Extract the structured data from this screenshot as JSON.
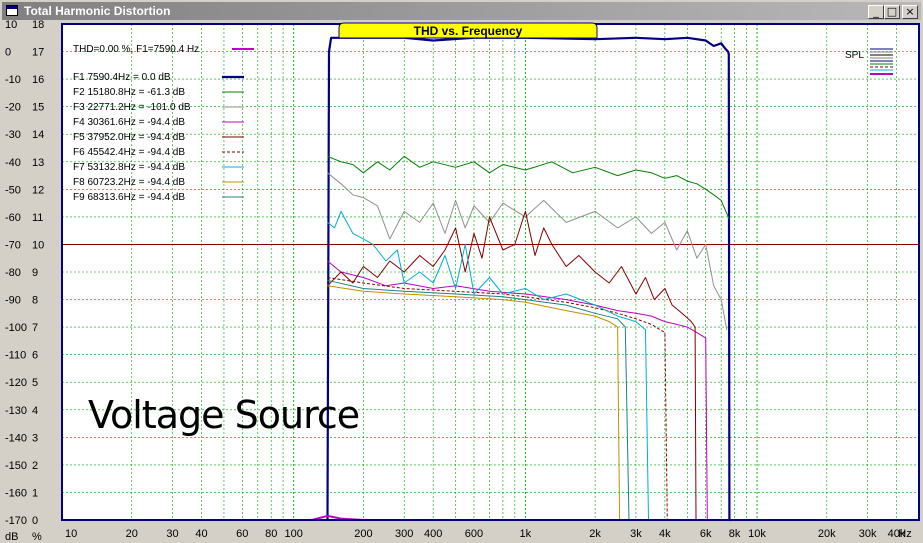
{
  "window": {
    "title": "Total Harmonic Distortion",
    "minimize_glyph": "_",
    "maximize_glyph": "□",
    "close_glyph": "×"
  },
  "colors": {
    "plot_bg": "#ffffff",
    "grid": "#00a000",
    "ref_line": "#800000",
    "title_tab": "#ffff00",
    "axis_border": "#000080"
  },
  "watermark": "Voltage Source",
  "chart_data": {
    "type": "line",
    "title": "THD vs. Frequency",
    "x_scale": "log",
    "xlim": [
      10,
      50000
    ],
    "ylim": [
      -170,
      10
    ],
    "y2lim": [
      0,
      18
    ],
    "x_ticks": [
      "10",
      "20",
      "30",
      "40",
      "60",
      "80",
      "100",
      "200",
      "300",
      "400",
      "600",
      "1k",
      "2k",
      "3k",
      "4k",
      "6k",
      "8k",
      "10k",
      "20k",
      "30k",
      "40k"
    ],
    "x_tick_values": [
      10,
      20,
      30,
      40,
      60,
      80,
      100,
      200,
      300,
      400,
      600,
      1000,
      2000,
      3000,
      4000,
      6000,
      8000,
      10000,
      20000,
      30000,
      40000
    ],
    "x_unit": "Hz",
    "y_ticks": [
      "10",
      "0",
      "-10",
      "-20",
      "-30",
      "-40",
      "-50",
      "-60",
      "-70",
      "-80",
      "-90",
      "-100",
      "-110",
      "-120",
      "-130",
      "-140",
      "-150",
      "-160",
      "-170"
    ],
    "y2_ticks": [
      "18",
      "17",
      "16",
      "15",
      "14",
      "13",
      "12",
      "11",
      "10",
      "9",
      "8",
      "7",
      "6",
      "5",
      "4",
      "3",
      "2",
      "1",
      "0"
    ],
    "y_unit": "dB",
    "y2_unit": "%",
    "legend_header": "THD=0.00 %, F1=7590.4 Hz",
    "spl_label": "SPL",
    "reference_line_db": -70,
    "series": [
      {
        "name": "F1 7590.4Hz = 0.0 dB",
        "color": "#000080",
        "width": 2.2,
        "x": [
          140,
          142,
          145,
          200,
          300,
          400,
          600,
          1000,
          2000,
          3000,
          4000,
          5000,
          6000,
          6500,
          7000,
          7300,
          7500,
          7550,
          7600,
          7650,
          7700,
          7700
        ],
        "y": [
          -170,
          0,
          5,
          5,
          5,
          4,
          5,
          5,
          4.5,
          5,
          4.5,
          5,
          4,
          2,
          3,
          1,
          0,
          -1,
          -170,
          -170,
          -170,
          -170
        ]
      },
      {
        "name": "F2 15180.8Hz = -61.3 dB",
        "color": "#008000",
        "width": 1,
        "x": [
          140,
          160,
          180,
          200,
          230,
          260,
          300,
          350,
          400,
          500,
          600,
          700,
          800,
          1000,
          1300,
          1600,
          2000,
          2500,
          3000,
          3500,
          4000,
          4500,
          5000,
          5500,
          6000,
          6500,
          7000,
          7600
        ],
        "y": [
          -38,
          -40,
          -41,
          -44,
          -40,
          -43,
          -38,
          -42,
          -40,
          -42,
          -40,
          -44,
          -41,
          -43,
          -40,
          -44,
          -42,
          -45,
          -43,
          -44,
          -46,
          -45,
          -47,
          -48,
          -50,
          -52,
          -54,
          -61
        ]
      },
      {
        "name": "F3 22771.2Hz = -101.0 dB",
        "color": "#909090",
        "width": 1,
        "x": [
          140,
          160,
          180,
          200,
          230,
          260,
          300,
          350,
          400,
          450,
          500,
          550,
          600,
          700,
          800,
          1000,
          1200,
          1500,
          2000,
          2500,
          3000,
          3500,
          4000,
          4500,
          5000,
          5500,
          6000,
          6500,
          7000,
          7400
        ],
        "y": [
          -44,
          -48,
          -52,
          -53,
          -56,
          -68,
          -58,
          -62,
          -55,
          -66,
          -54,
          -64,
          -56,
          -62,
          -55,
          -60,
          -54,
          -62,
          -58,
          -64,
          -60,
          -66,
          -62,
          -72,
          -65,
          -75,
          -70,
          -85,
          -90,
          -101
        ]
      },
      {
        "name": "F4 30361.6Hz = -94.4 dB",
        "color": "#c000c0",
        "width": 1,
        "x": [
          140,
          160,
          200,
          250,
          300,
          400,
          500,
          700,
          1000,
          1500,
          2000,
          2500,
          3000,
          3500,
          4000,
          4500,
          5000,
          5500,
          6000,
          6100,
          6150
        ],
        "y": [
          -76,
          -80,
          -82,
          -85,
          -84,
          -86,
          -85,
          -87,
          -88,
          -90,
          -92,
          -94,
          -95,
          -96,
          -98,
          -99,
          -100,
          -102,
          -104,
          -170,
          -170
        ]
      },
      {
        "name": "F5 37952.0Hz = -94.4 dB",
        "color": "#800000",
        "width": 1,
        "x": [
          140,
          160,
          180,
          200,
          230,
          260,
          300,
          350,
          400,
          450,
          500,
          550,
          600,
          650,
          700,
          800,
          900,
          1000,
          1100,
          1200,
          1300,
          1500,
          1700,
          2000,
          2300,
          2600,
          3000,
          3300,
          3600,
          4000,
          4300,
          4600,
          4900,
          5200,
          5400,
          5450
        ],
        "y": [
          -85,
          -80,
          -84,
          -78,
          -82,
          -76,
          -80,
          -74,
          -78,
          -72,
          -64,
          -80,
          -66,
          -75,
          -60,
          -72,
          -70,
          -58,
          -74,
          -64,
          -70,
          -78,
          -74,
          -80,
          -84,
          -78,
          -88,
          -82,
          -90,
          -86,
          -92,
          -94,
          -96,
          -98,
          -100,
          -170
        ]
      },
      {
        "name": "F6 45542.4Hz = -94.4 dB",
        "color": "#800000",
        "width": 1,
        "dash": "3,2",
        "x": [
          140,
          200,
          300,
          500,
          800,
          1000,
          1500,
          2000,
          2500,
          3000,
          3500,
          4000,
          4100
        ],
        "y": [
          -82,
          -84,
          -86,
          -87,
          -88,
          -89,
          -91,
          -93,
          -95,
          -97,
          -99,
          -102,
          -170
        ]
      },
      {
        "name": "F7 53132.8Hz = -94.4 dB",
        "color": "#00b0d0",
        "width": 1,
        "x": [
          140,
          150,
          160,
          180,
          200,
          220,
          250,
          280,
          300,
          350,
          400,
          450,
          500,
          550,
          600,
          700,
          800,
          1000,
          1200,
          1500,
          2000,
          2500,
          3000,
          3300,
          3400
        ],
        "y": [
          -62,
          -64,
          -58,
          -66,
          -68,
          -70,
          -76,
          -72,
          -84,
          -80,
          -84,
          -74,
          -86,
          -70,
          -88,
          -82,
          -88,
          -86,
          -90,
          -88,
          -92,
          -96,
          -98,
          -101,
          -170
        ]
      },
      {
        "name": "F8 60723.2Hz = -94.4 dB",
        "color": "#c09000",
        "width": 1,
        "x": [
          140,
          200,
          300,
          500,
          800,
          1000,
          1500,
          2000,
          2300,
          2500,
          2550,
          2600
        ],
        "y": [
          -85,
          -87,
          -88,
          -89,
          -90,
          -91,
          -94,
          -96,
          -98,
          -100,
          -170,
          -170
        ]
      },
      {
        "name": "F9 68313.6Hz = -94.4 dB",
        "color": "#208080",
        "width": 1,
        "x": [
          140,
          200,
          300,
          500,
          800,
          1000,
          1500,
          2000,
          2500,
          2700,
          2800
        ],
        "y": [
          -83,
          -86,
          -87,
          -88,
          -89,
          -90,
          -92,
          -95,
          -97,
          -100,
          -170
        ]
      },
      {
        "name": "THD",
        "color": "#c000c0",
        "width": 2,
        "x": [
          10,
          120,
          140,
          160,
          200,
          1000,
          10000,
          50000
        ],
        "y": [
          -170,
          -170,
          -168.5,
          -169.5,
          -170,
          -170,
          -170,
          -170
        ]
      }
    ]
  }
}
